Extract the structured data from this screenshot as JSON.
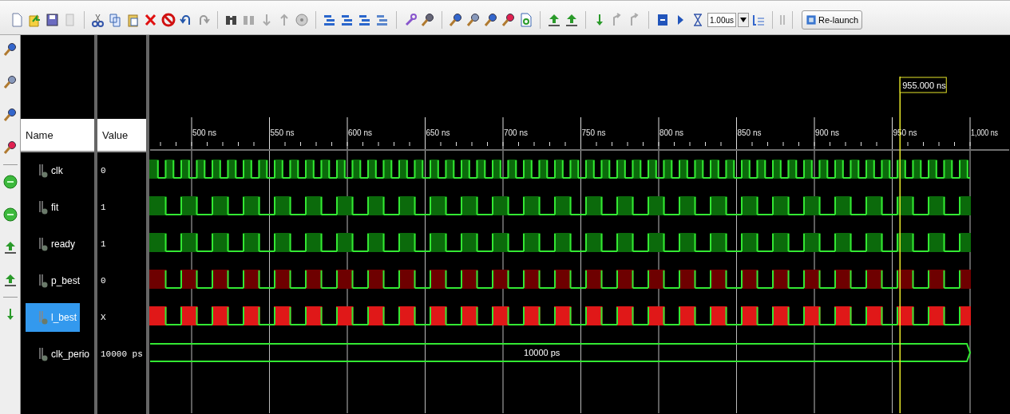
{
  "toolbar": {
    "time_field": {
      "value": "1.00us"
    },
    "relaunch_button": {
      "label": "Re-launch"
    }
  },
  "wave_window": {
    "columns": [
      "Name",
      "Value"
    ],
    "time_axis": {
      "labels": [
        "500 ns",
        "550 ns",
        "600 ns",
        "650 ns",
        "700 ns",
        "750 ns",
        "800 ns",
        "850 ns",
        "900 ns",
        "950 ns",
        "1,000 ns"
      ]
    },
    "cursor": {
      "label": "955.000 ns"
    },
    "signals": [
      {
        "name": "clk",
        "value": "0",
        "kind": "clock",
        "color": "#0b6a0b",
        "selected": false
      },
      {
        "name": "fit",
        "value": "1",
        "kind": "bit",
        "color": "#0b6a0b",
        "selected": false
      },
      {
        "name": "ready",
        "value": "1",
        "kind": "bit",
        "color": "#0b6a0b",
        "selected": false
      },
      {
        "name": "p_best",
        "value": "0",
        "kind": "bit",
        "color": "#6e0000",
        "selected": false
      },
      {
        "name": "l_best",
        "value": "X",
        "kind": "bit",
        "color": "#e01818",
        "selected": true
      },
      {
        "name": "clk_perio",
        "value": "10000 ps",
        "kind": "bus",
        "bus_label": "10000 ps",
        "selected": false
      }
    ]
  }
}
